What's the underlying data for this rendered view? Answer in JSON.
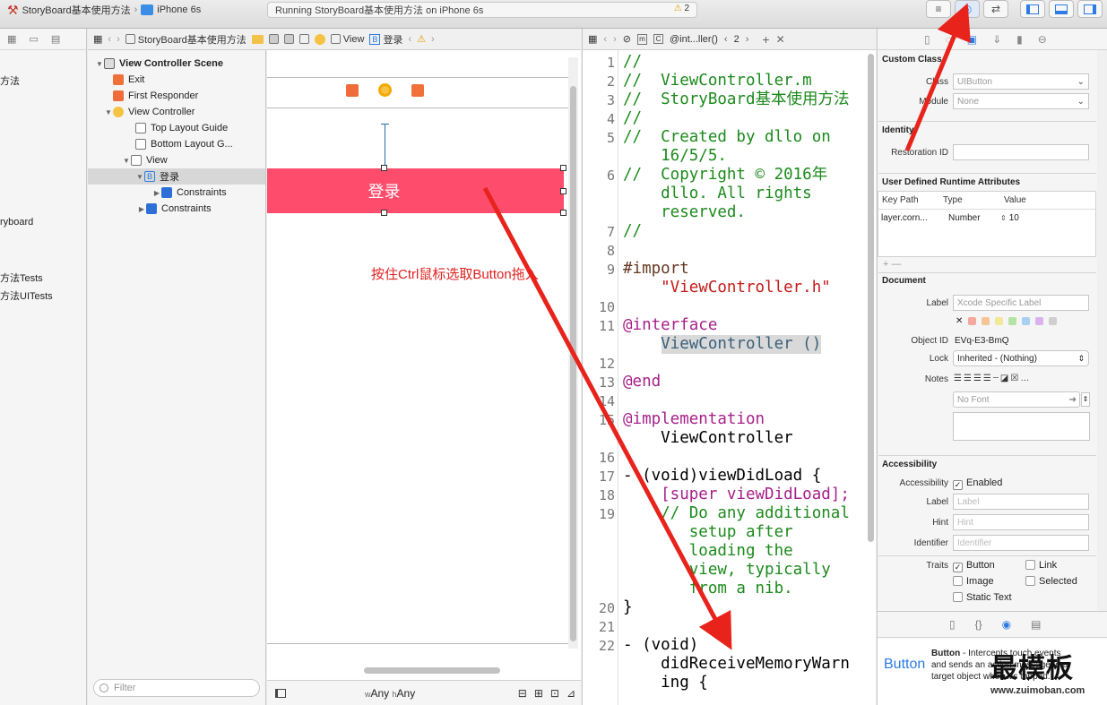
{
  "toolbar": {
    "scheme": "StoryBoard基本使用方法",
    "device": "iPhone 6s",
    "status": "Running StoryBoard基本使用方法 on iPhone 6s",
    "warnings": "2"
  },
  "navigator": {
    "items": [
      "方法",
      "ryboard",
      "方法Tests",
      "方法UITests"
    ],
    "filter_placeholder": "Filter"
  },
  "ib_jumpbar": {
    "crumbs": [
      "StoryBoard基本使用方法",
      "View",
      "登录"
    ]
  },
  "outline": {
    "scene": "View Controller Scene",
    "exit": "Exit",
    "first_responder": "First Responder",
    "view_controller": "View Controller",
    "top_guide": "Top Layout Guide",
    "bottom_guide": "Bottom Layout G...",
    "view": "View",
    "button": "登录",
    "constraints_inner": "Constraints",
    "constraints_outer": "Constraints"
  },
  "canvas": {
    "button_label": "登录",
    "annotation": "按住Ctrl鼠标选取Button拖入",
    "size_w_prefix": "w",
    "size_w": "Any",
    "size_h_prefix": "h",
    "size_h": "Any",
    "button_color": "#fe4c6c",
    "annotation_color": "#e02020"
  },
  "code_jumpbar": {
    "file": "@int...ller()",
    "counter": "2"
  },
  "code": {
    "lines": [
      {
        "n": "1",
        "t": "//",
        "c": "cm"
      },
      {
        "n": "2",
        "t": "//  ViewController.m",
        "c": "cm"
      },
      {
        "n": "3",
        "t": "//  StoryBoard基本使用方法",
        "c": "cm"
      },
      {
        "n": "4",
        "t": "//",
        "c": "cm"
      },
      {
        "n": "5",
        "t": "//  Created by dllo on",
        "c": "cm"
      },
      {
        "n": "",
        "t": "    16/5/5.",
        "c": "cm"
      },
      {
        "n": "6",
        "t": "//  Copyright © 2016年",
        "c": "cm"
      },
      {
        "n": "",
        "t": "    dllo. All rights",
        "c": "cm"
      },
      {
        "n": "",
        "t": "    reserved.",
        "c": "cm"
      },
      {
        "n": "7",
        "t": "//",
        "c": "cm"
      },
      {
        "n": "8",
        "t": "",
        "c": ""
      },
      {
        "n": "9",
        "t": "#import",
        "c": "pp"
      },
      {
        "n": "",
        "t": "    \"ViewController.h\"",
        "c": "str"
      },
      {
        "n": "10",
        "t": "",
        "c": ""
      },
      {
        "n": "11",
        "t": "@interface",
        "c": "kw"
      },
      {
        "n": "",
        "t": "    ViewController ()",
        "c": "cls"
      },
      {
        "n": "12",
        "t": "",
        "c": ""
      },
      {
        "n": "13",
        "t": "@end",
        "c": "kw"
      },
      {
        "n": "14",
        "t": "",
        "c": ""
      },
      {
        "n": "15",
        "t": "@implementation",
        "c": "kw"
      },
      {
        "n": "",
        "t": "    ViewController",
        "c": ""
      },
      {
        "n": "16",
        "t": "",
        "c": ""
      },
      {
        "n": "17",
        "t": "- (void)viewDidLoad {",
        "c": "mix1"
      },
      {
        "n": "18",
        "t": "    [super viewDidLoad];",
        "c": "mix2"
      },
      {
        "n": "19",
        "t": "    // Do any additional",
        "c": "cm"
      },
      {
        "n": "",
        "t": "       setup after",
        "c": "cm"
      },
      {
        "n": "",
        "t": "       loading the",
        "c": "cm"
      },
      {
        "n": "",
        "t": "       view, typically",
        "c": "cm"
      },
      {
        "n": "",
        "t": "       from a nib.",
        "c": "cm"
      },
      {
        "n": "20",
        "t": "}",
        "c": ""
      },
      {
        "n": "21",
        "t": "",
        "c": ""
      },
      {
        "n": "22",
        "t": "- (void)",
        "c": "mix3"
      },
      {
        "n": "",
        "t": "    didReceiveMemoryWarn",
        "c": ""
      },
      {
        "n": "",
        "t": "    ing {",
        "c": ""
      }
    ]
  },
  "inspector": {
    "custom_class_header": "Custom Class",
    "class_label": "Class",
    "class_placeholder": "UIButton",
    "module_label": "Module",
    "module_value": "None",
    "identity_header": "Identity",
    "restoration_label": "Restoration ID",
    "udra_header": "User Defined Runtime Attributes",
    "col_keypath": "Key Path",
    "col_type": "Type",
    "col_value": "Value",
    "row_keypath": "layer.corn...",
    "row_type": "Number",
    "row_value": "10",
    "add_remove": "+ —",
    "document_header": "Document",
    "label_label": "Label",
    "label_placeholder": "Xcode Specific Label",
    "object_id_label": "Object ID",
    "object_id": "EVq-E3-BmQ",
    "lock_label": "Lock",
    "lock_value": "Inherited - (Nothing)",
    "notes_label": "Notes",
    "font_placeholder": "No Font",
    "accessibility_header": "Accessibility",
    "accessibility_label": "Accessibility",
    "enabled": "Enabled",
    "acc_label_label": "Label",
    "acc_label_ph": "Label",
    "hint_label": "Hint",
    "hint_ph": "Hint",
    "identifier_label": "Identifier",
    "identifier_ph": "Identifier",
    "traits_label": "Traits",
    "trait_button": "Button",
    "trait_link": "Link",
    "trait_image": "Image",
    "trait_selected": "Selected",
    "trait_static": "Static Text",
    "library_title": "Button",
    "library_name": "Button",
    "library_desc1": " - Intercepts touch events",
    "library_desc2": "and sends an action message to a",
    "library_desc3": "target object when it's tapped.",
    "watermark": "最模板",
    "watermark_url": "www.zuimoban.com"
  }
}
